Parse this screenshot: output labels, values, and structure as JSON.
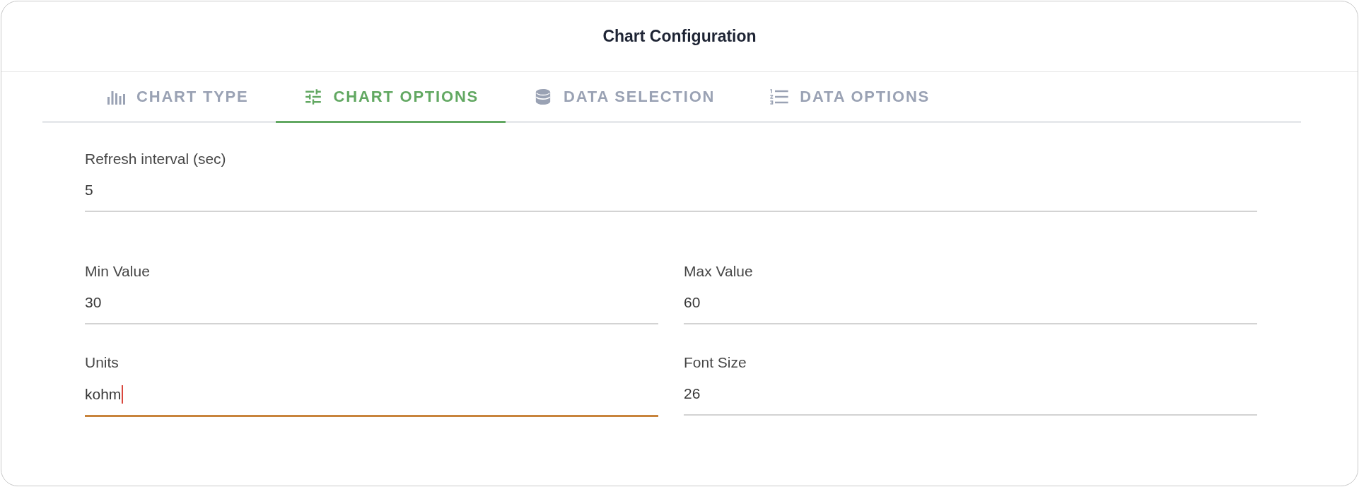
{
  "window": {
    "title": "Chart Configuration"
  },
  "tabs": [
    {
      "label": "CHART TYPE",
      "selected": false
    },
    {
      "label": "CHART OPTIONS",
      "selected": true
    },
    {
      "label": "DATA SELECTION",
      "selected": false
    },
    {
      "label": "DATA OPTIONS",
      "selected": false
    }
  ],
  "form": {
    "rows": [
      [
        {
          "label": "Refresh interval (sec)",
          "value": "5",
          "focused": false
        }
      ],
      [
        {
          "label": "Min Value",
          "value": "30",
          "focused": false
        },
        {
          "label": "Max Value",
          "value": "60",
          "focused": false
        }
      ],
      [
        {
          "label": "Units",
          "value": "kohm",
          "focused": true
        },
        {
          "label": "Font Size",
          "value": "26",
          "focused": false
        }
      ]
    ]
  }
}
